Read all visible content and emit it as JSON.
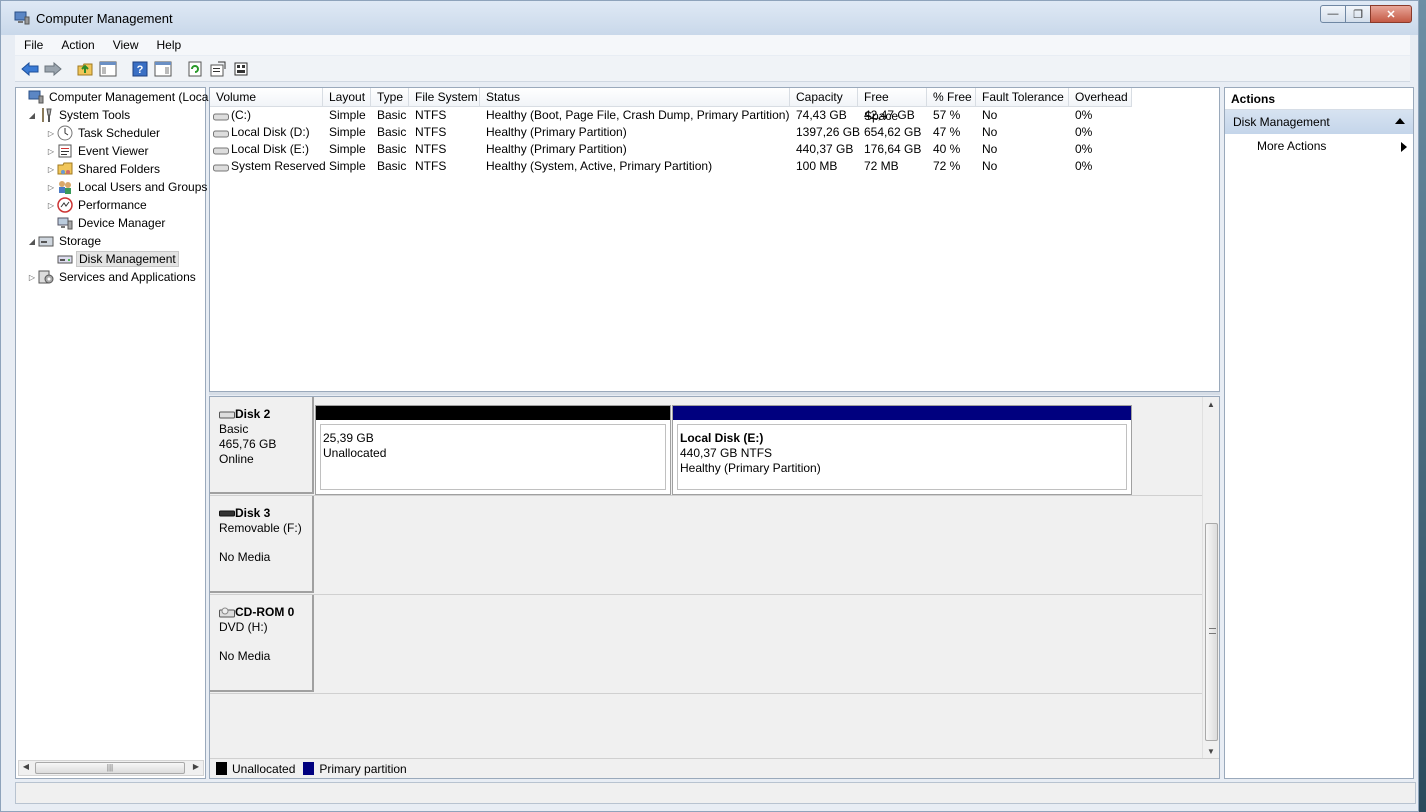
{
  "window": {
    "title": "Computer Management"
  },
  "menu": [
    "File",
    "Action",
    "View",
    "Help"
  ],
  "toolbar": [
    "back-icon",
    "forward-icon",
    "up-folder-icon",
    "show-hide-tree-icon",
    "help-icon",
    "show-hide-action-pane-icon",
    "refresh-icon",
    "properties-icon",
    "export-icon"
  ],
  "tree": {
    "root": "Computer Management (Local",
    "system_tools": "System Tools",
    "task_scheduler": "Task Scheduler",
    "event_viewer": "Event Viewer",
    "shared_folders": "Shared Folders",
    "local_users": "Local Users and Groups",
    "performance": "Performance",
    "device_manager": "Device Manager",
    "storage": "Storage",
    "disk_management": "Disk Management",
    "services": "Services and Applications"
  },
  "volumes": {
    "columns": [
      "Volume",
      "Layout",
      "Type",
      "File System",
      "Status",
      "Capacity",
      "Free Space",
      "% Free",
      "Fault Tolerance",
      "Overhead"
    ],
    "rows": [
      [
        "(C:)",
        "Simple",
        "Basic",
        "NTFS",
        "Healthy (Boot, Page File, Crash Dump, Primary Partition)",
        "74,43 GB",
        "42,47 GB",
        "57 %",
        "No",
        "0%"
      ],
      [
        "Local Disk (D:)",
        "Simple",
        "Basic",
        "NTFS",
        "Healthy (Primary Partition)",
        "1397,26 GB",
        "654,62 GB",
        "47 %",
        "No",
        "0%"
      ],
      [
        "Local Disk (E:)",
        "Simple",
        "Basic",
        "NTFS",
        "Healthy (Primary Partition)",
        "440,37 GB",
        "176,64 GB",
        "40 %",
        "No",
        "0%"
      ],
      [
        "System Reserved",
        "Simple",
        "Basic",
        "NTFS",
        "Healthy (System, Active, Primary Partition)",
        "100 MB",
        "72 MB",
        "72 %",
        "No",
        "0%"
      ]
    ]
  },
  "disks": {
    "disk2": {
      "name": "Disk 2",
      "type": "Basic",
      "size": "465,76 GB",
      "status": "Online",
      "p1": {
        "size": "25,39 GB",
        "desc": "Unallocated"
      },
      "p2": {
        "name": "Local Disk  (E:)",
        "size": "440,37 GB NTFS",
        "desc": "Healthy (Primary Partition)"
      }
    },
    "disk3": {
      "name": "Disk 3",
      "type": "Removable (F:)",
      "status": "No Media"
    },
    "cdrom": {
      "name": "CD-ROM 0",
      "type": "DVD (H:)",
      "status": "No Media"
    }
  },
  "legend": {
    "unallocated": "Unallocated",
    "primary": "Primary partition"
  },
  "actions": {
    "title": "Actions",
    "section": "Disk Management",
    "more": "More Actions"
  },
  "colors": {
    "unallocated": "#000000",
    "primary": "#00007f",
    "selected_header": "#c4d5ea"
  }
}
